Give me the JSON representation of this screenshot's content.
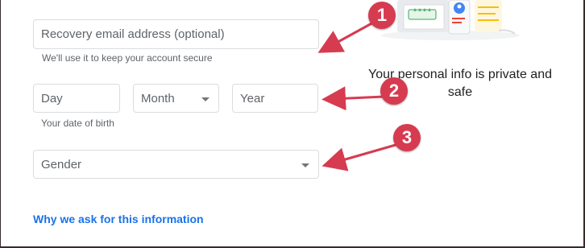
{
  "form": {
    "recovery_email": {
      "placeholder": "Recovery email address (optional)",
      "helper": "We'll use it to keep your account secure"
    },
    "birth": {
      "day_placeholder": "Day",
      "month_value": "Month",
      "year_placeholder": "Year",
      "helper": "Your date of birth"
    },
    "gender": {
      "value": "Gender"
    },
    "why_link": "Why we ask for this information"
  },
  "illustration": {
    "card_text": "****",
    "caption": "Your personal info is private and safe"
  },
  "annotations": [
    {
      "label": "1"
    },
    {
      "label": "2"
    },
    {
      "label": "3"
    }
  ],
  "colors": {
    "accent_link": "#1a73e8",
    "annotation": "#d63b50",
    "field_border": "#dadce0"
  }
}
